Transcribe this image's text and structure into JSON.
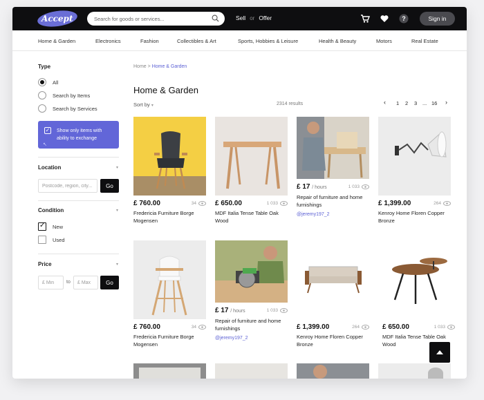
{
  "header": {
    "logo_text": "Accept",
    "search_placeholder": "Search for goods or services...",
    "sell_label": "Sell",
    "or_label": "or",
    "offer_label": "Offer",
    "signin_label": "Sign in",
    "accent_color": "#6266d8"
  },
  "categories": [
    "Home & Garden",
    "Electronics",
    "Fashion",
    "Collectibles & Art",
    "Sports, Hobbies & Leisure",
    "Health & Beauty",
    "Motors",
    "Real Estate"
  ],
  "sidebar": {
    "type_title": "Type",
    "type_options": [
      "All",
      "Search by Items",
      "Search by Services"
    ],
    "type_selected": "All",
    "exchange_label": "Show only items with ability to exchange",
    "location_title": "Location",
    "location_placeholder": "Postcode, region, city...",
    "go_label": "Go",
    "condition_title": "Condition",
    "condition_options": [
      "New",
      "Used"
    ],
    "price_title": "Price",
    "price_min_placeholder": "£ Min",
    "price_to": "to",
    "price_max_placeholder": "£ Max"
  },
  "main": {
    "breadcrumb_home": "Home",
    "breadcrumb_sep": ">",
    "breadcrumb_current": "Home & Garden",
    "page_title": "Home & Garden",
    "sort_label": "Sort by",
    "results_count": "2314 results",
    "pages": [
      "1",
      "2",
      "3",
      "...",
      "16"
    ]
  },
  "products": [
    {
      "price": "£ 760.00",
      "unit": "",
      "views": "34",
      "title": "Fredericia Furniture Borge Mogensen",
      "user": "",
      "icon": "armchair-image"
    },
    {
      "price": "£ 650.00",
      "unit": "",
      "views": "1 033",
      "title": "MDF Italia Tense Table Oak Wood",
      "user": "",
      "icon": "wooden-table-image"
    },
    {
      "price": "£ 17",
      "unit": "/ hours",
      "views": "1 033",
      "title": "Repair of furniture and home furnishings",
      "user": "@jeremy197_2",
      "icon": "carpenter-image"
    },
    {
      "price": "£ 1,399.00",
      "unit": "",
      "views": "264",
      "title": "Kenroy Home Floren Copper Bronze",
      "user": "",
      "icon": "wall-lamp-image"
    },
    {
      "price": "£ 760.00",
      "unit": "",
      "views": "34",
      "title": "Fredericia Furniture Borge Mogensen",
      "user": "",
      "icon": "high-chair-image"
    },
    {
      "price": "£ 17",
      "unit": "/ hours",
      "views": "1 033",
      "title": "Repair of furniture and home furnishings",
      "user": "@jeremy197_2",
      "icon": "circular-saw-image"
    },
    {
      "price": "£ 1,399.00",
      "unit": "",
      "views": "264",
      "title": "Kenroy Home Floren Copper Bronze",
      "user": "",
      "icon": "sofa-image"
    },
    {
      "price": "£ 650.00",
      "unit": "",
      "views": "1 033",
      "title": "MDF Italia Tense Table Oak Wood",
      "user": "",
      "icon": "round-table-image"
    }
  ]
}
